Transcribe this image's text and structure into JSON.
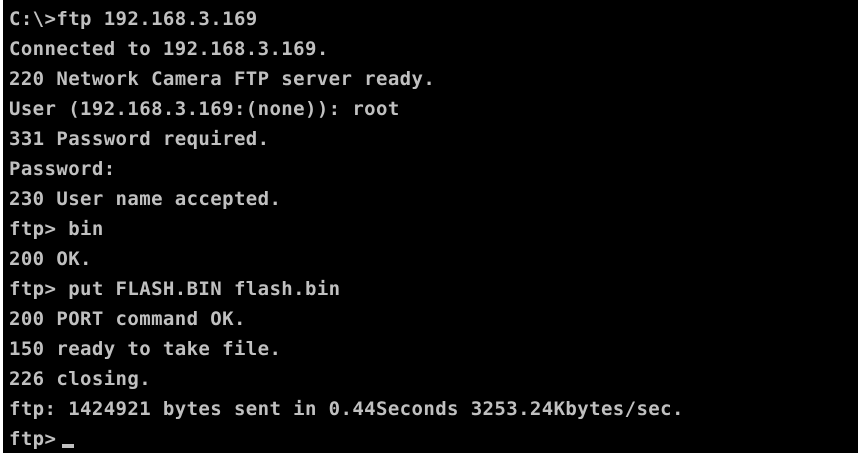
{
  "terminal": {
    "colors": {
      "background": "#000000",
      "text": "#c0c0c0",
      "left_border": "#ffffff"
    },
    "lines": [
      "C:\\>ftp 192.168.3.169",
      "Connected to 192.168.3.169.",
      "220 Network Camera FTP server ready.",
      "User (192.168.3.169:(none)): root",
      "331 Password required.",
      "Password:",
      "230 User name accepted.",
      "ftp> bin",
      "200 OK.",
      "ftp> put FLASH.BIN flash.bin",
      "200 PORT command OK.",
      "150 ready to take file.",
      "226 closing.",
      "ftp: 1424921 bytes sent in 0.44Seconds 3253.24Kbytes/sec."
    ],
    "current_prompt": "ftp>"
  }
}
